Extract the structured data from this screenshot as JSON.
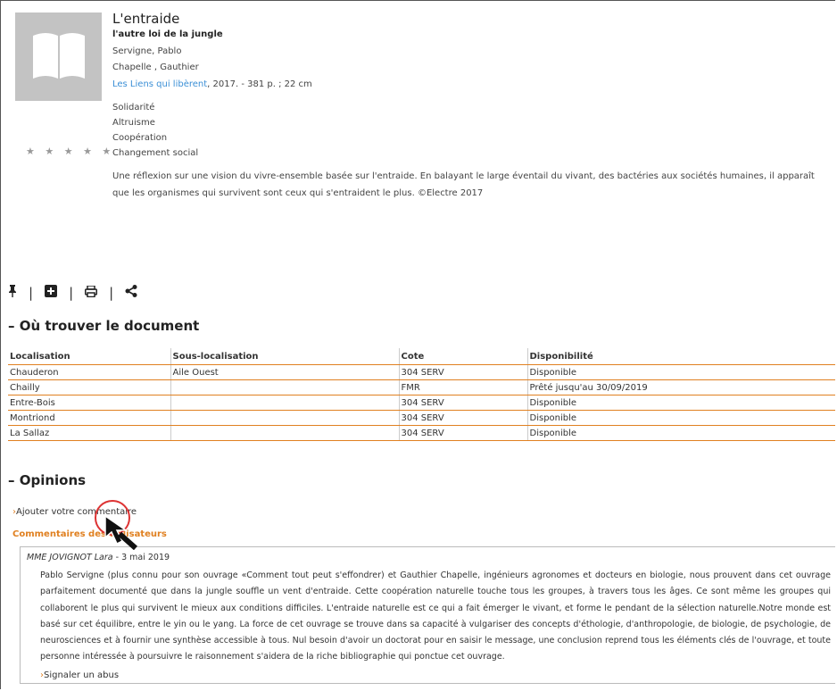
{
  "record": {
    "title": "L'entraide",
    "subtitle": "l'autre loi de la jungle",
    "authors": [
      "Servigne, Pablo",
      "Chapelle , Gauthier"
    ],
    "publisher": "Les Liens qui libèrent",
    "publication_rest": ", 2017. - 381 p. ; 22 cm",
    "subjects": [
      "Solidarité",
      "Altruisme",
      "Coopération",
      "Changement social"
    ],
    "rating_stars": "★ ★ ★ ★ ★",
    "description": "Une réflexion sur une vision du vivre-ensemble basée sur l'entraide. En balayant le large éventail du vivant, des bactéries aux sociétés humaines, il apparaît que les organismes qui survivent sont ceux qui s'entraident le plus. ©Electre 2017"
  },
  "actions": {
    "icons": [
      "pin-icon",
      "add-icon",
      "print-icon",
      "share-icon"
    ],
    "separator": "|"
  },
  "where": {
    "heading": "Où trouver le document",
    "toggle": "–",
    "columns": [
      "Localisation",
      "Sous-localisation",
      "Cote",
      "Disponibilité"
    ],
    "rows": [
      [
        "Chauderon",
        "Aile Ouest",
        "304 SERV",
        "Disponible"
      ],
      [
        "Chailly",
        "",
        "FMR",
        "Prêté jusqu'au 30/09/2019"
      ],
      [
        "Entre-Bois",
        "",
        "304 SERV",
        "Disponible"
      ],
      [
        "Montriond",
        "",
        "304 SERV",
        "Disponible"
      ],
      [
        "La Sallaz",
        "",
        "304 SERV",
        "Disponible"
      ]
    ]
  },
  "opinions": {
    "heading": "Opinions",
    "toggle": "–",
    "add_comment": "Ajouter votre commentaire",
    "users_comments_heading": "Commentaires des utilisateurs",
    "chevron": "›",
    "comment": {
      "author": "MME JOVIGNOT Lara",
      "date": " - 3 mai 2019",
      "text": "Pablo Servigne (plus connu pour son ouvrage «Comment tout peut s'effondrer) et Gauthier Chapelle, ingénieurs agronomes et docteurs en biologie, nous prouvent dans cet ouvrage parfaitement documenté que dans la jungle souffle un vent d'entraide. Cette coopération naturelle touche tous les groupes, à travers tous les âges. Ce sont même les groupes qui collaborent le plus qui survivent le mieux aux conditions difficiles. L'entraide naturelle est ce qui a fait émerger le vivant, et forme le pendant de la sélection naturelle.Notre monde est basé sur cet équilibre, entre le yin ou le yang. La force de cet ouvrage se trouve dans sa capacité à vulgariser des concepts d'éthologie, d'anthropologie, de biologie, de psychologie, de neurosciences et à fournir une synthèse accessible à tous. Nul besoin d'avoir un doctorat pour en saisir le message, une conclusion reprend tous les éléments clés de l'ouvrage, et toute personne intéressée à poursuivre le raisonnement s'aidera de la riche bibliographie qui ponctue cet ouvrage.",
      "report": "Signaler un abus"
    }
  },
  "colors": {
    "link": "#3b8fd6",
    "accent": "#e08020",
    "cover": "#c3c3c3"
  }
}
